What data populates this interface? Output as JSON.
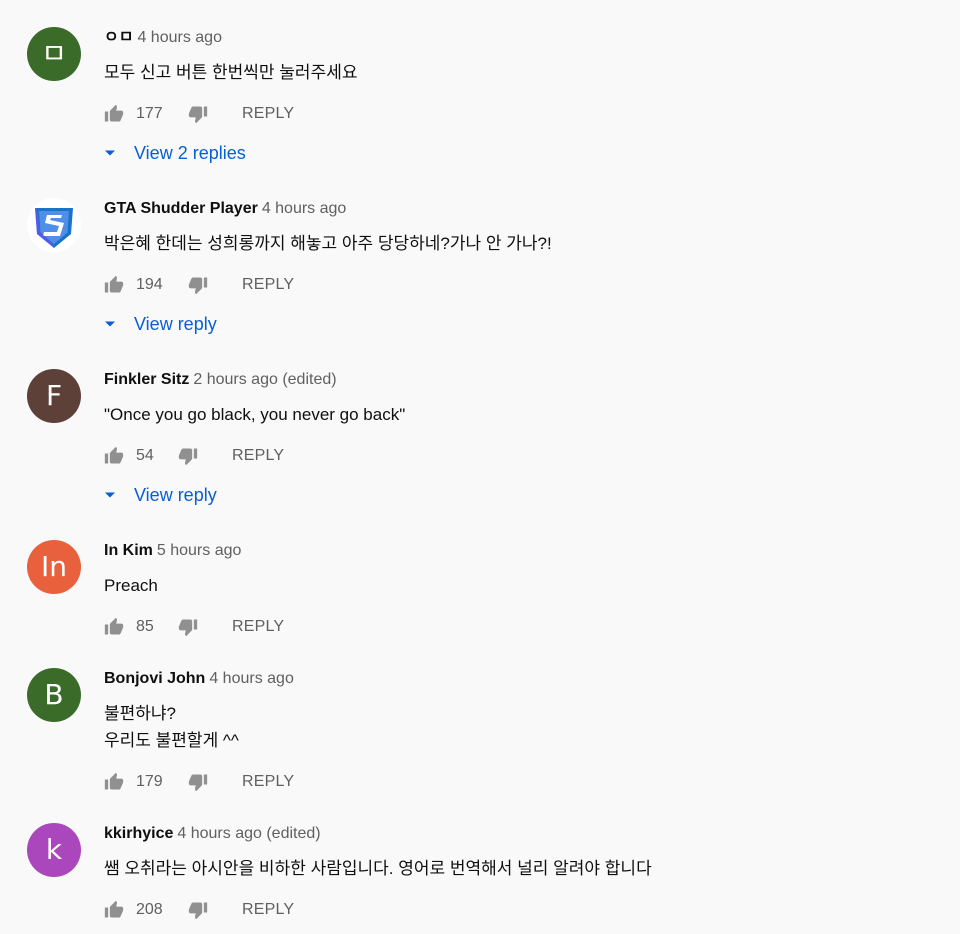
{
  "comments": [
    {
      "avatar_letter": "ㅁ",
      "avatar_color": "#3a6b29",
      "author": "ㅇㅁ",
      "time": "4 hours ago",
      "lines": [
        "모두 신고 버튼 한번씩만 눌러주세요"
      ],
      "likes": "177",
      "reply_label": "REPLY",
      "view_replies": "View 2 replies"
    },
    {
      "avatar_icon": "shield-s-logo-icon",
      "author": "GTA Shudder Player",
      "time": "4 hours ago",
      "lines": [
        "박은혜 한데는 성희롱까지 해놓고 아주 당당하네?가나 안 가나?!"
      ],
      "likes": "194",
      "reply_label": "REPLY",
      "view_replies": "View reply"
    },
    {
      "avatar_letter": "F",
      "avatar_color": "#5d4037",
      "author": "Finkler Sitz",
      "time": "2 hours ago (edited)",
      "lines": [
        "\"Once you go black, you never go back\""
      ],
      "likes": "54",
      "reply_label": "REPLY",
      "view_replies": "View reply"
    },
    {
      "avatar_letter": "In",
      "avatar_color": "#e8603c",
      "author": "In Kim",
      "time": "5 hours ago",
      "lines": [
        "Preach"
      ],
      "likes": "85",
      "reply_label": "REPLY"
    },
    {
      "avatar_letter": "B",
      "avatar_color": "#3a6b29",
      "author": "Bonjovi John",
      "time": "4 hours ago",
      "lines": [
        "불편하냐?",
        "우리도 불편할게 ^^"
      ],
      "likes": "179",
      "reply_label": "REPLY"
    },
    {
      "avatar_letter": "k",
      "avatar_color": "#ab47bc",
      "author": "kkirhyice",
      "time": "4 hours ago (edited)",
      "lines": [
        "쌤 오취라는 아시안을 비하한 사람입니다. 영어로 번역해서 널리 알려야 합니다"
      ],
      "likes": "208",
      "reply_label": "REPLY"
    }
  ],
  "colors": {
    "link": "#065fd4",
    "secondary_text": "#606060",
    "background": "#f9f9f9"
  }
}
